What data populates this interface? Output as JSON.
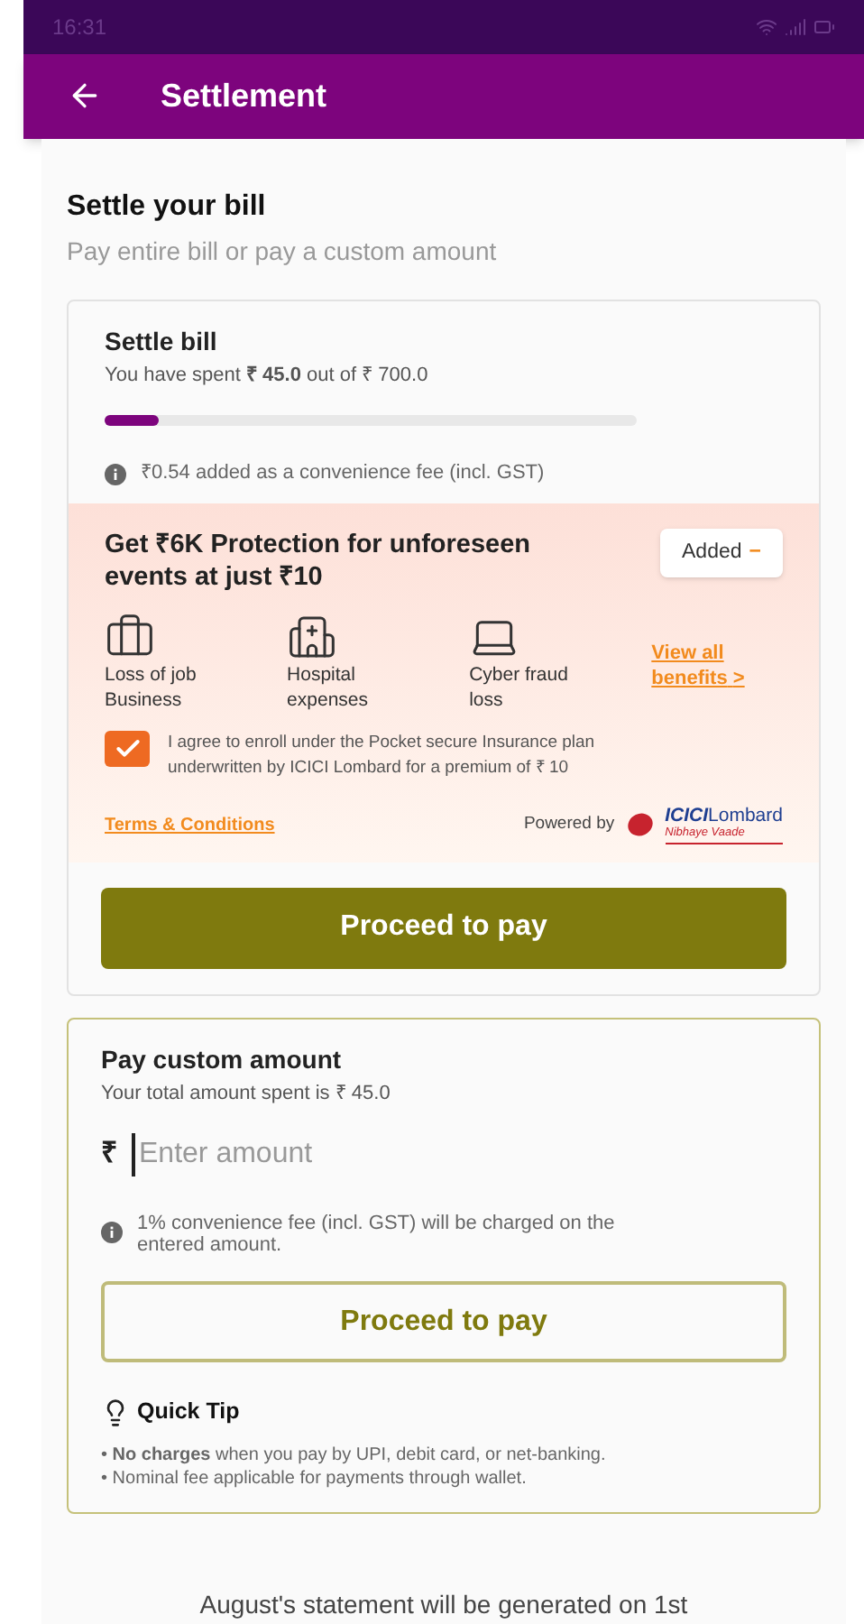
{
  "status_bar": {
    "time": "16:31"
  },
  "header": {
    "title": "Settlement"
  },
  "intro": {
    "title": "Settle your bill",
    "subtitle": "Pay entire bill or pay a custom amount"
  },
  "settle_card": {
    "title": "Settle bill",
    "spent_text": "You have spent **₹ 45.0** out of ₹ 700.0",
    "level": 0.1,
    "fee_note": "₹0.54 added as a convenience fee (incl. GST)",
    "protection": {
      "title": "Get ₹6K Protection for unforeseen events at just ₹10",
      "added_label": "Added",
      "added_sign": "−",
      "benefits": [
        {
          "kind": "briefcase",
          "label": "Loss of job Business"
        },
        {
          "kind": "hospital",
          "label": "Hospital expenses"
        },
        {
          "kind": "laptop",
          "label": "Cyber fraud loss"
        }
      ],
      "view_all": "View all benefits",
      "view_all_arrow": ">",
      "agree": {
        "checked": true,
        "text": "I agree to enroll under the Pocket secure Insurance plan underwritten by ICICI Lombard for a premium of ₹ 10"
      },
      "terms": "Terms & Conditions",
      "powered_by": "Powered by",
      "brand": "ICICI",
      "brand_suffix": "Lombard",
      "tagline": "Nibhaye Vaade"
    },
    "button": "Proceed to pay"
  },
  "custom_card": {
    "title": "Pay custom amount",
    "subtitle": "Your total amount spent is ₹ 45.0",
    "currency": "₹",
    "placeholder": "Enter amount",
    "fee_note": "1% convenience fee (incl. GST) will be charged on the entered amount.",
    "button": "Proceed to pay",
    "tip": {
      "title": "Quick Tip",
      "lines": [
        "• **No charges** when you pay by UPI, debit card, or net-banking.",
        "• Nominal fee applicable for payments through wallet."
      ]
    }
  },
  "footer": "August's statement will be generated on 1st"
}
